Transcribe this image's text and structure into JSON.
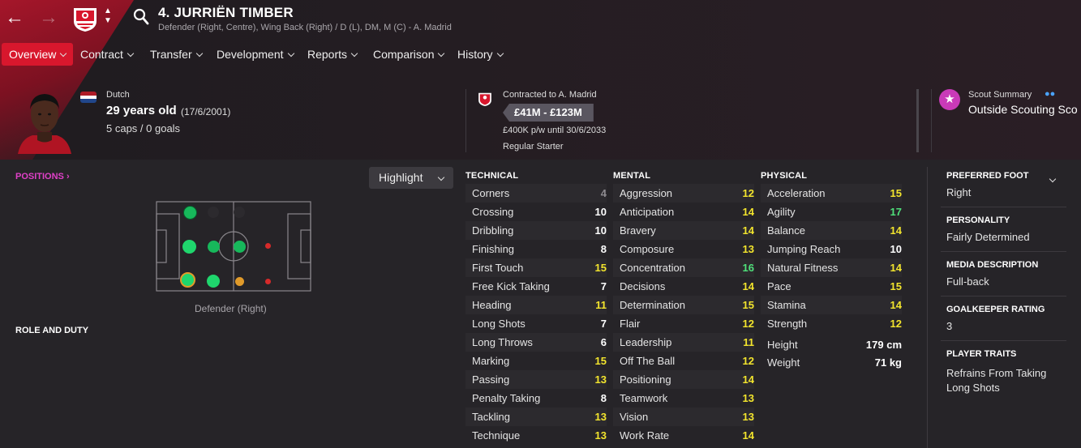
{
  "header": {
    "player_name": "4. JURRIËN TIMBER",
    "positions_line": "Defender (Right, Centre), Wing Back (Right) / D (L), DM, M (C) - A. Madrid"
  },
  "tabs": [
    {
      "label": "Overview"
    },
    {
      "label": "Contract"
    },
    {
      "label": "Transfer"
    },
    {
      "label": "Development"
    },
    {
      "label": "Reports"
    },
    {
      "label": "Comparison"
    },
    {
      "label": "History"
    }
  ],
  "profile": {
    "nationality": "Dutch",
    "age": "29 years old",
    "dob": "(17/6/2001)",
    "caps": "5 caps / 0 goals"
  },
  "contract": {
    "club": "Contracted to A. Madrid",
    "value": "£41M - £123M",
    "wage": "£400K p/w until 30/6/2033",
    "status": "Regular Starter"
  },
  "scout": {
    "title": "Scout Summary",
    "status": "Outside Scouting Sco"
  },
  "positions": {
    "header": "POSITIONS",
    "highlight": "Highlight",
    "caption": "Defender (Right)",
    "role_header": "ROLE AND DUTY"
  },
  "colors": {
    "accent": "#d8172d",
    "natural": "#1fd66d",
    "accomplished": "#17b85b",
    "unconvincing": "#e09a2a",
    "awkward": "#d62a2a",
    "val_white": "#ffffff",
    "val_yellow": "#f2e42d",
    "val_green": "#4fe07a",
    "val_grey": "#8e8b90"
  },
  "technical": {
    "title": "TECHNICAL",
    "rows": [
      {
        "name": "Corners",
        "value": "4"
      },
      {
        "name": "Crossing",
        "value": "10"
      },
      {
        "name": "Dribbling",
        "value": "10"
      },
      {
        "name": "Finishing",
        "value": "8"
      },
      {
        "name": "First Touch",
        "value": "15"
      },
      {
        "name": "Free Kick Taking",
        "value": "7"
      },
      {
        "name": "Heading",
        "value": "11"
      },
      {
        "name": "Long Shots",
        "value": "7"
      },
      {
        "name": "Long Throws",
        "value": "6"
      },
      {
        "name": "Marking",
        "value": "15"
      },
      {
        "name": "Passing",
        "value": "13"
      },
      {
        "name": "Penalty Taking",
        "value": "8"
      },
      {
        "name": "Tackling",
        "value": "13"
      },
      {
        "name": "Technique",
        "value": "13"
      }
    ]
  },
  "mental": {
    "title": "MENTAL",
    "rows": [
      {
        "name": "Aggression",
        "value": "12"
      },
      {
        "name": "Anticipation",
        "value": "14"
      },
      {
        "name": "Bravery",
        "value": "14"
      },
      {
        "name": "Composure",
        "value": "13"
      },
      {
        "name": "Concentration",
        "value": "16"
      },
      {
        "name": "Decisions",
        "value": "14"
      },
      {
        "name": "Determination",
        "value": "15"
      },
      {
        "name": "Flair",
        "value": "12"
      },
      {
        "name": "Leadership",
        "value": "11"
      },
      {
        "name": "Off The Ball",
        "value": "12"
      },
      {
        "name": "Positioning",
        "value": "14"
      },
      {
        "name": "Teamwork",
        "value": "13"
      },
      {
        "name": "Vision",
        "value": "13"
      },
      {
        "name": "Work Rate",
        "value": "14"
      }
    ]
  },
  "physical": {
    "title": "PHYSICAL",
    "rows": [
      {
        "name": "Acceleration",
        "value": "15"
      },
      {
        "name": "Agility",
        "value": "17"
      },
      {
        "name": "Balance",
        "value": "14"
      },
      {
        "name": "Jumping Reach",
        "value": "10"
      },
      {
        "name": "Natural Fitness",
        "value": "14"
      },
      {
        "name": "Pace",
        "value": "15"
      },
      {
        "name": "Stamina",
        "value": "14"
      },
      {
        "name": "Strength",
        "value": "12"
      }
    ],
    "height_label": "Height",
    "height_value": "179 cm",
    "weight_label": "Weight",
    "weight_value": "71 kg"
  },
  "info": {
    "foot_h": "PREFERRED FOOT",
    "foot_v": "Right",
    "personality_h": "PERSONALITY",
    "personality_v": "Fairly Determined",
    "media_h": "MEDIA DESCRIPTION",
    "media_v": "Full-back",
    "gk_h": "GOALKEEPER RATING",
    "gk_v": "3",
    "traits_h": "PLAYER TRAITS",
    "traits_v1": "Refrains From Taking",
    "traits_v2": "Long Shots"
  }
}
